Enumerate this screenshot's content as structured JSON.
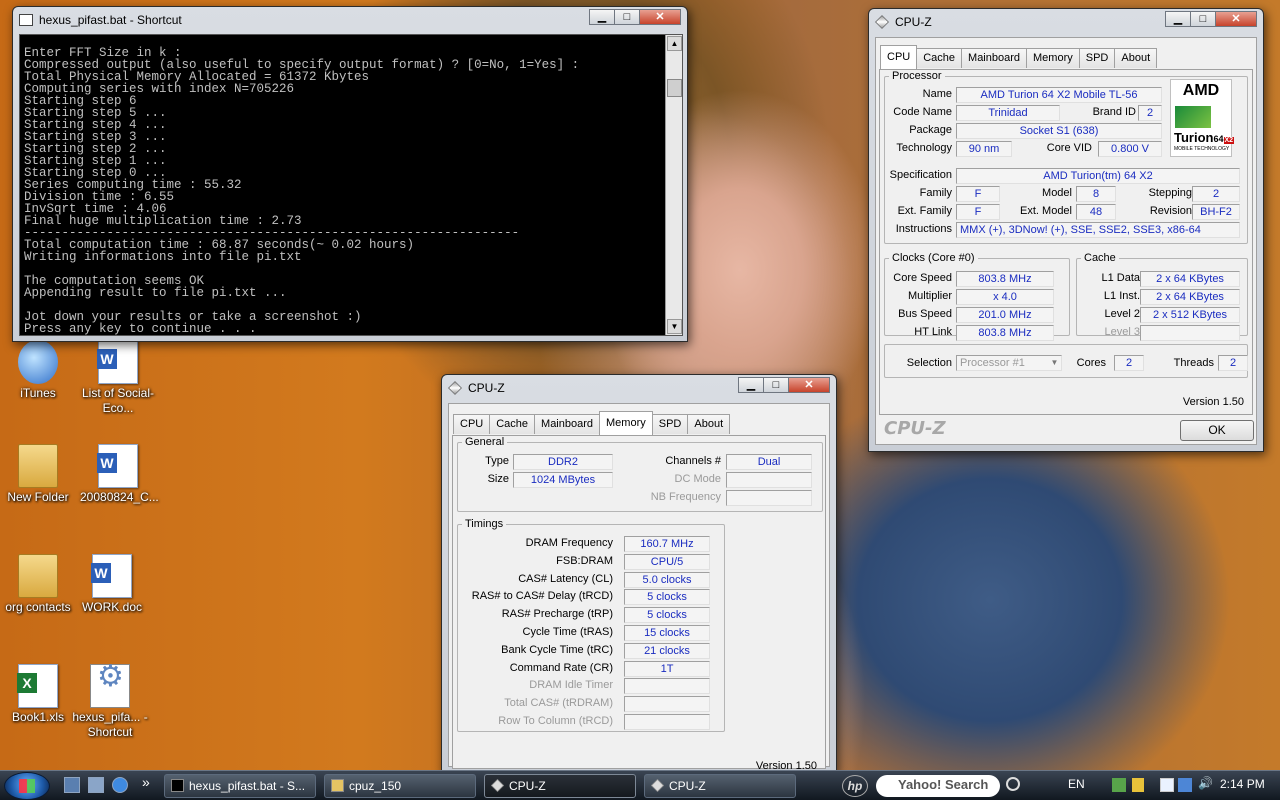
{
  "desktop": {
    "icons": [
      {
        "label": "iTunes",
        "type": "app"
      },
      {
        "label": "List of Social-Eco...",
        "type": "doc"
      },
      {
        "label": "New Folder",
        "type": "folder"
      },
      {
        "label": "20080824_C...",
        "type": "doc"
      },
      {
        "label": "org contacts",
        "type": "folder"
      },
      {
        "label": "WORK.doc",
        "type": "doc"
      },
      {
        "label": "Book1.xls",
        "type": "xls"
      },
      {
        "label": "hexus_pifa... - Shortcut",
        "type": "shortcut"
      }
    ]
  },
  "console": {
    "title": "hexus_pifast.bat - Shortcut",
    "lines": "Enter FFT Size in k :\nCompressed output (also useful to specify output format) ? [0=No, 1=Yes] :\nTotal Physical Memory Allocated = 61372 Kbytes\nComputing series with index N=705226\nStarting step 6\nStarting step 5 ...\nStarting step 4 ...\nStarting step 3 ...\nStarting step 2 ...\nStarting step 1 ...\nStarting step 0 ...\nSeries computing time : 55.32\nDivision time : 6.55\nInvSqrt time : 4.06\nFinal huge multiplication time : 2.73\n------------------------------------------------------------------\nTotal computation time : 68.87 seconds(~ 0.02 hours)\nWriting informations into file pi.txt\n\nThe computation seems OK\nAppending result to file pi.txt ...\n\nJot down your results or take a screenshot :)\nPress any key to continue . . ."
  },
  "cpuz_cpu": {
    "title": "CPU-Z",
    "tabs": [
      "CPU",
      "Cache",
      "Mainboard",
      "Memory",
      "SPD",
      "About"
    ],
    "active_tab": "CPU",
    "processor_legend": "Processor",
    "name_label": "Name",
    "name": "AMD Turion 64 X2 Mobile TL-56",
    "codename_label": "Code Name",
    "codename": "Trinidad",
    "brandid_label": "Brand ID",
    "brandid": "2",
    "package_label": "Package",
    "package": "Socket S1 (638)",
    "technology_label": "Technology",
    "technology": "90 nm",
    "corevid_label": "Core VID",
    "corevid": "0.800 V",
    "spec_label": "Specification",
    "spec": "AMD Turion(tm) 64 X2",
    "family_label": "Family",
    "family": "F",
    "model_label": "Model",
    "model": "8",
    "stepping_label": "Stepping",
    "stepping": "2",
    "extfamily_label": "Ext. Family",
    "extfamily": "F",
    "extmodel_label": "Ext. Model",
    "extmodel": "48",
    "revision_label": "Revision",
    "revision": "BH-F2",
    "instructions_label": "Instructions",
    "instructions": "MMX (+), 3DNow! (+), SSE, SSE2, SSE3, x86-64",
    "clocks_legend": "Clocks (Core #0)",
    "corespeed_label": "Core Speed",
    "corespeed": "803.8 MHz",
    "multiplier_label": "Multiplier",
    "multiplier": "x 4.0",
    "busspeed_label": "Bus Speed",
    "busspeed": "201.0 MHz",
    "htlink_label": "HT Link",
    "htlink": "803.8 MHz",
    "cache_legend": "Cache",
    "l1data_label": "L1 Data",
    "l1data": "2 x 64 KBytes",
    "l1inst_label": "L1 Inst.",
    "l1inst": "2 x 64 KBytes",
    "level2_label": "Level 2",
    "level2": "2 x 512 KBytes",
    "level3_label": "Level 3",
    "level3": "",
    "selection_label": "Selection",
    "selection": "Processor #1",
    "cores_label": "Cores",
    "cores": "2",
    "threads_label": "Threads",
    "threads": "2",
    "version": "Version 1.50",
    "brand": "CPU-Z",
    "ok": "OK",
    "logo_top": "AMD",
    "logo_model": "Turion",
    "logo_suffix": "64",
    "logo_x2": "X2",
    "logo_sub": "MOBILE TECHNOLOGY"
  },
  "cpuz_mem": {
    "title": "CPU-Z",
    "tabs": [
      "CPU",
      "Cache",
      "Mainboard",
      "Memory",
      "SPD",
      "About"
    ],
    "active_tab": "Memory",
    "general_legend": "General",
    "type_label": "Type",
    "type": "DDR2",
    "size_label": "Size",
    "size": "1024 MBytes",
    "channels_label": "Channels #",
    "channels": "Dual",
    "dcmode_label": "DC Mode",
    "dcmode": "",
    "nbfreq_label": "NB Frequency",
    "nbfreq": "",
    "timings_legend": "Timings",
    "timings": [
      {
        "label": "DRAM Frequency",
        "value": "160.7 MHz",
        "dim": false
      },
      {
        "label": "FSB:DRAM",
        "value": "CPU/5",
        "dim": false
      },
      {
        "label": "CAS# Latency (CL)",
        "value": "5.0 clocks",
        "dim": false
      },
      {
        "label": "RAS# to CAS# Delay (tRCD)",
        "value": "5 clocks",
        "dim": false
      },
      {
        "label": "RAS# Precharge (tRP)",
        "value": "5 clocks",
        "dim": false
      },
      {
        "label": "Cycle Time (tRAS)",
        "value": "15 clocks",
        "dim": false
      },
      {
        "label": "Bank Cycle Time (tRC)",
        "value": "21 clocks",
        "dim": false
      },
      {
        "label": "Command Rate (CR)",
        "value": "1T",
        "dim": false
      },
      {
        "label": "DRAM Idle Timer",
        "value": "",
        "dim": true
      },
      {
        "label": "Total CAS# (tRDRAM)",
        "value": "",
        "dim": true
      },
      {
        "label": "Row To Column (tRCD)",
        "value": "",
        "dim": true
      }
    ],
    "version": "Version 1.50"
  },
  "taskbar": {
    "tasks": [
      {
        "label": "hexus_pifast.bat - S...",
        "active": false
      },
      {
        "label": "cpuz_150",
        "active": false
      },
      {
        "label": "CPU-Z",
        "active": true
      },
      {
        "label": "CPU-Z",
        "active": false
      }
    ],
    "chevron": "»",
    "search_placeholder": "Yahoo! Search",
    "hp": "hp",
    "lang": "EN",
    "clock": "2:14 PM"
  }
}
